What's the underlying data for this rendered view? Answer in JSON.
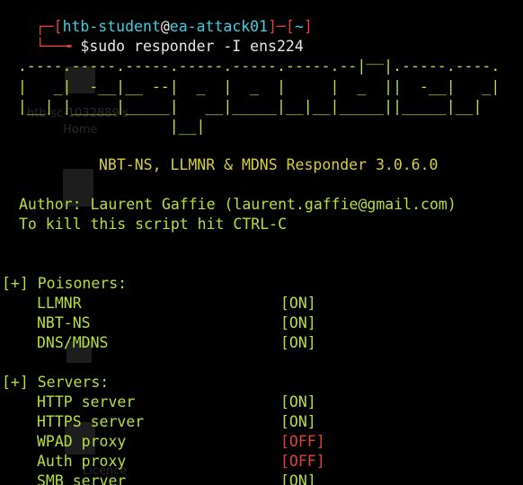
{
  "prompt": {
    "bracket_open": "┌─[",
    "user": "htb-student",
    "at": "@",
    "host": "ea-attack01",
    "sep": "]─[",
    "cwd": "~",
    "bracket_close": "]",
    "second_prefix": "└──╼ ",
    "dollar": "$",
    "command": "sudo responder -I ens224"
  },
  "banner": [
    "                                         __",
    "  .----.-----.-----.-----.-----.-----.--|  |.-----.----.",
    "  |   _|  -__|__ --|  _  |  _  |     |  _  ||  -__|   _|",
    "  |__| |_____|_____|   __|_____|__|__|_____||_____|__|",
    "                   |__|"
  ],
  "title": "NBT-NS, LLMNR & MDNS Responder 3.0.6.0",
  "author_line": "Author: Laurent Gaffie (laurent.gaffie@gmail.com)",
  "kill_line": "To kill this script hit CTRL-C",
  "sections": [
    {
      "header": "[+] Poisoners:",
      "items": [
        {
          "name": "LLMNR",
          "status": "[ON]"
        },
        {
          "name": "NBT-NS",
          "status": "[ON]"
        },
        {
          "name": "DNS/MDNS",
          "status": "[ON]"
        }
      ]
    },
    {
      "header": "[+] Servers:",
      "items": [
        {
          "name": "HTTP server",
          "status": "[ON]"
        },
        {
          "name": "HTTPS server",
          "status": "[ON]"
        },
        {
          "name": "WPAD proxy",
          "status": "[OFF]"
        },
        {
          "name": "Auth proxy",
          "status": "[OFF]"
        },
        {
          "name": "SMB server",
          "status": "[ON]"
        }
      ]
    }
  ],
  "background_desktop": {
    "label_1": "htb-sc-1032889's",
    "label_2": "Home",
    "label_3": "Licence"
  },
  "colors": {
    "background": "#000000",
    "prompt_red": "#e0413b",
    "prompt_cyan": "#3fd0e0",
    "text_yellow": "#d6cf3a",
    "status_on": "#b5e03a",
    "status_off": "#e0413b"
  }
}
